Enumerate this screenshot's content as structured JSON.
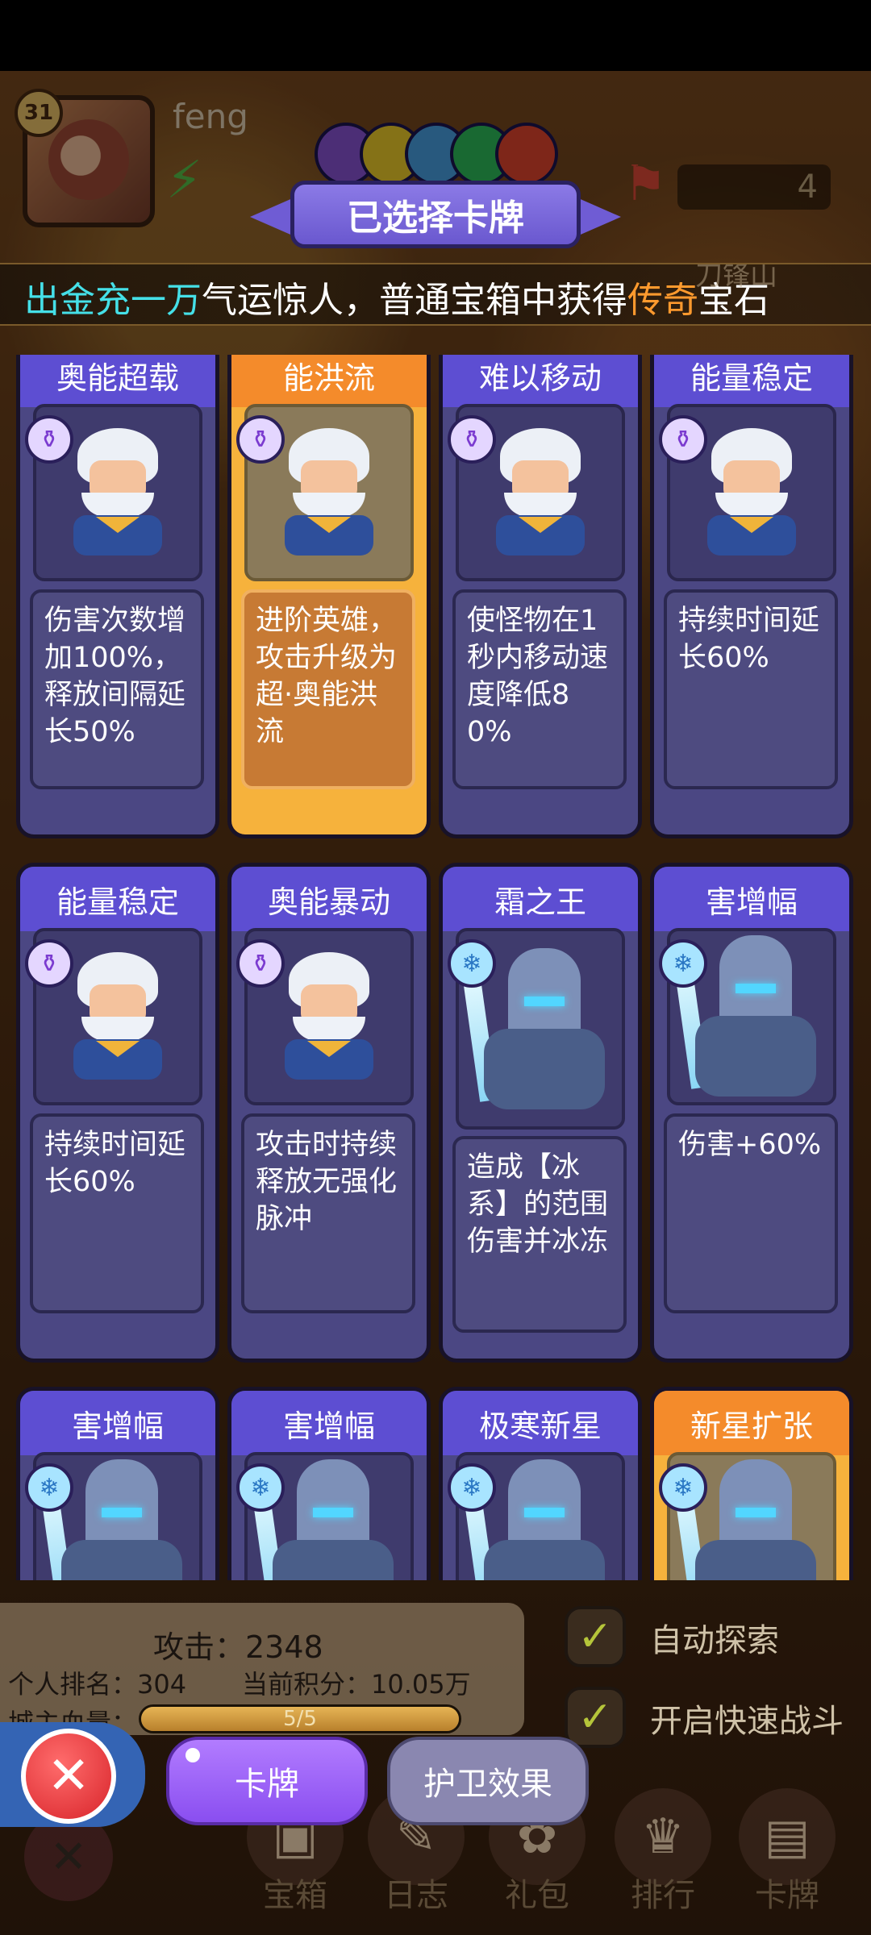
{
  "player": {
    "level": "31",
    "name": "feng",
    "trophy_count": "4"
  },
  "title": "已选择卡牌",
  "marquee": {
    "part1": "出金充一万",
    "part2": "气运惊人，普通宝箱中获得",
    "part3": "传奇",
    "part4": "宝石",
    "faded_location": "刀锋山"
  },
  "cards": [
    {
      "title": "奥能超载",
      "desc": "伤害次数增加100%，释放间隔延长50%"
    },
    {
      "title": "能洪流",
      "desc": "进阶英雄，攻击升级为超·奥能洪流"
    },
    {
      "title": "难以移动",
      "desc": "使怪物在1秒内移动速度降低80%"
    },
    {
      "title": "能量稳定",
      "desc": "持续时间延长60%"
    },
    {
      "title": "能量稳定",
      "desc": "持续时间延长60%"
    },
    {
      "title": "奥能暴动",
      "desc": "攻击时持续释放无强化脉冲"
    },
    {
      "title": "霜之王",
      "desc": "造成【冰系】的范围伤害并冰冻"
    },
    {
      "title": "害增幅",
      "desc": "伤害+60%"
    },
    {
      "title": "害增幅",
      "desc": ""
    },
    {
      "title": "害增幅",
      "desc": ""
    },
    {
      "title": "极寒新星",
      "desc": ""
    },
    {
      "title": "新星扩张",
      "desc": ""
    }
  ],
  "stats": {
    "attack": "攻击：2348",
    "rank": "个人排名：304",
    "score": "当前积分：10.05万",
    "hp_label": "城主血量：",
    "hp_text": "5/5",
    "hp_fraction": 1.0
  },
  "toggles": {
    "auto_explore": "自动探索",
    "fast_battle": "开启快速战斗"
  },
  "tabs": {
    "cards": "卡牌",
    "guard_effect": "护卫效果"
  },
  "nav": [
    "宝箱",
    "日志",
    "礼包",
    "排行",
    "卡牌"
  ],
  "colors": {
    "card_head": "#5d4ed2",
    "selected_card": "#f6b23c",
    "accent_purple": "#8a4ef0"
  }
}
